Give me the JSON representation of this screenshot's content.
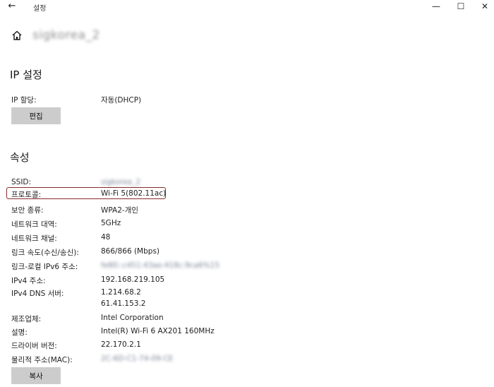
{
  "window": {
    "title": "설정",
    "back_glyph": "←",
    "minimize_glyph": "—",
    "maximize_glyph": "☐",
    "close_glyph": "✕"
  },
  "header": {
    "icon": "home-icon",
    "network_name": "sigkorea_2"
  },
  "ip_section": {
    "title": "IP 설정",
    "assignment_label": "IP 할당:",
    "assignment_value": "자동(DHCP)",
    "edit_button": "편집"
  },
  "properties": {
    "title": "속성",
    "highlight_color": "#8a2a2a",
    "rows": [
      {
        "label": "SSID:",
        "value": "sigkorea_2"
      },
      {
        "label": "프로토콜:",
        "value": "Wi-Fi 5(802.11ac)"
      },
      {
        "label": "보안 종류:",
        "value": "WPA2-개인"
      },
      {
        "label": "네트워크 대역:",
        "value": "5GHz"
      },
      {
        "label": "네트워크 채널:",
        "value": "48"
      },
      {
        "label": "링크 속도(수신/송신):",
        "value": "866/866 (Mbps)"
      },
      {
        "label": "링크-로컬 IPv6 주소:",
        "value": "fe80::c451:43ae:418c:9ca6%15"
      },
      {
        "label": "IPv4 주소:",
        "value": "192.168.219.105"
      },
      {
        "label": "IPv4 DNS 서버:",
        "value": "1.214.68.2",
        "value2": "61.41.153.2"
      },
      {
        "label": "제조업체:",
        "value": "Intel Corporation"
      },
      {
        "label": "설명:",
        "value": "Intel(R) Wi-Fi 6 AX201 160MHz"
      },
      {
        "label": "드라이버 버전:",
        "value": "22.170.2.1"
      },
      {
        "label": "물리적 주소(MAC):",
        "value": "2C-6D-C1-74-09-CE"
      }
    ],
    "copy_button": "복사"
  }
}
